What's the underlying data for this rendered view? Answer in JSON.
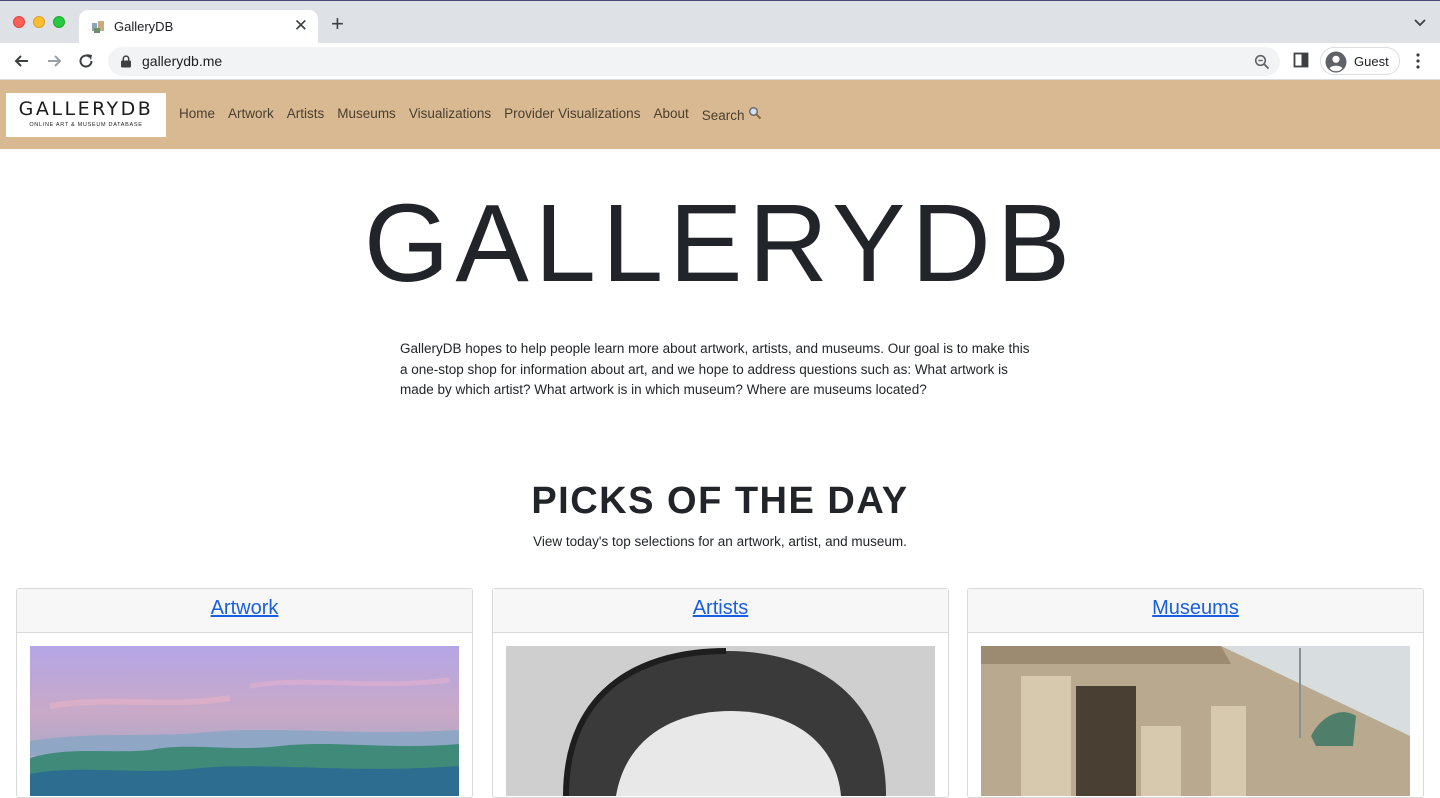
{
  "browser": {
    "tab_title": "GalleryDB",
    "tab_close": "✕",
    "new_tab": "+",
    "url": "gallerydb.me",
    "profile_label": "Guest"
  },
  "navbar": {
    "logo_main": "GALLERYDB",
    "logo_sub": "ONLINE ART & MUSEUM DATABASE",
    "links": [
      "Home",
      "Artwork",
      "Artists",
      "Museums",
      "Visualizations",
      "Provider Visualizations",
      "About",
      "Search"
    ]
  },
  "hero": {
    "title": "GALLERYDB",
    "intro": "GalleryDB hopes to help people learn more about artwork, artists, and museums. Our goal is to make this a one-stop shop for information about art, and we hope to address questions such as: What artwork is made by which artist? What artwork is in which museum? Where are museums located?"
  },
  "picks": {
    "title": "PICKS OF THE DAY",
    "subtitle": "View today's top selections for an artwork, artist, and museum.",
    "cards": [
      {
        "label": "Artwork"
      },
      {
        "label": "Artists"
      },
      {
        "label": "Museums"
      }
    ]
  },
  "colors": {
    "navbar_bg": "#d9b992",
    "link": "#1a5fe0",
    "text": "#212529"
  }
}
